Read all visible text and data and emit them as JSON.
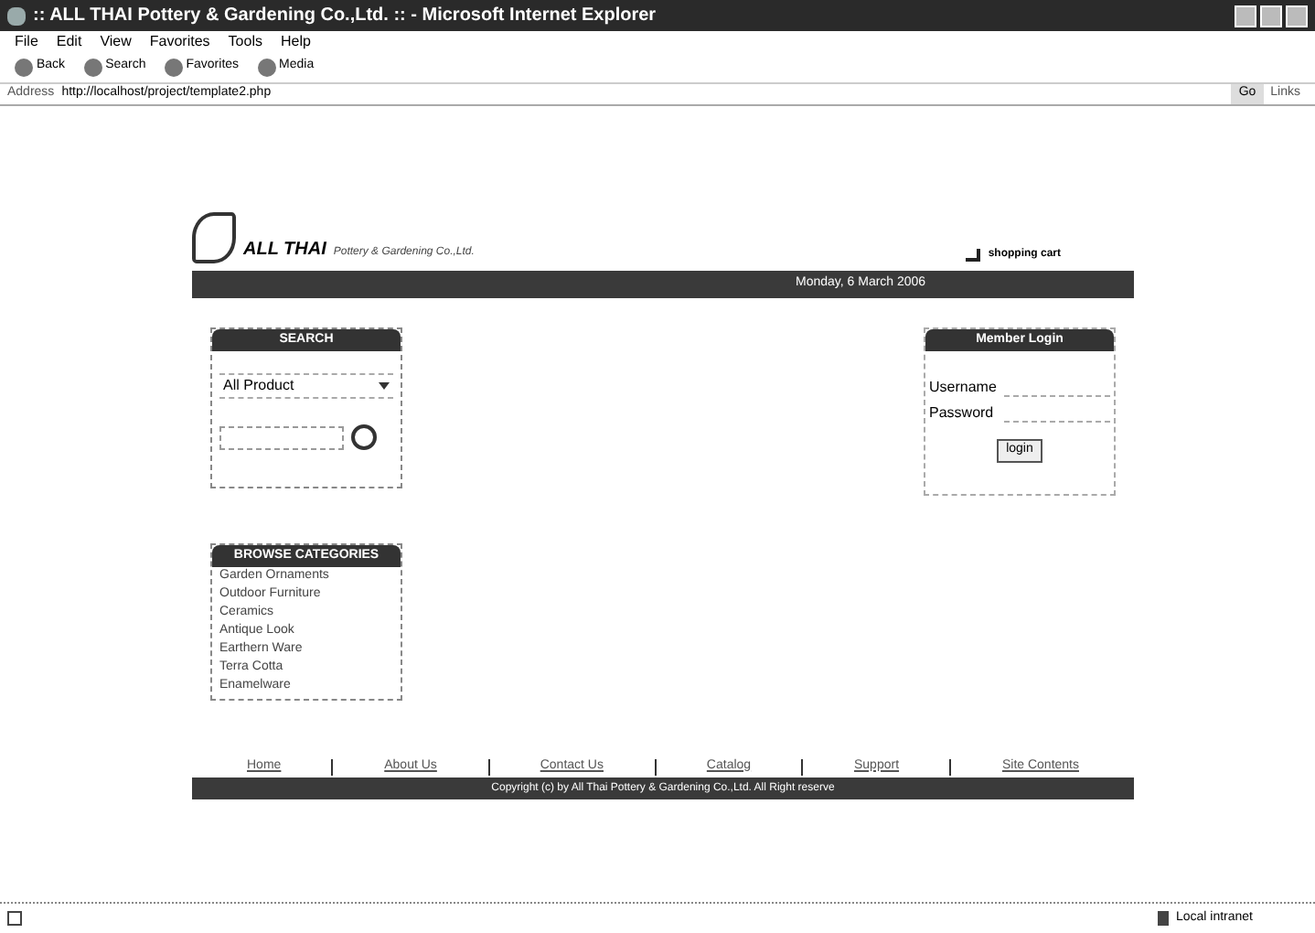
{
  "window": {
    "title": ":: ALL THAI Pottery & Gardening Co.,Ltd. :: - Microsoft Internet Explorer"
  },
  "menu": [
    "File",
    "Edit",
    "View",
    "Favorites",
    "Tools",
    "Help"
  ],
  "toolbar": [
    "Back",
    "Search",
    "Favorites",
    "Media"
  ],
  "address_bar": {
    "label": "Address",
    "url": "http://localhost/project/template2.php",
    "go": "Go",
    "links": "Links"
  },
  "site": {
    "logo_name": "ALL THAI",
    "logo_tagline": "Pottery & Gardening Co.,Ltd.",
    "cart": "shopping cart",
    "date": "Monday, 6 March 2006"
  },
  "search": {
    "title": "SEARCH",
    "category": "All Product"
  },
  "categories": {
    "title": "BROWSE CATEGORIES",
    "items": [
      "Garden Ornaments",
      "Outdoor Furniture",
      "Ceramics",
      "Antique Look",
      "Earthern Ware",
      "Terra Cotta",
      "Enamelware"
    ]
  },
  "login": {
    "title": "Member Login",
    "username_label": "Username",
    "password_label": "Password",
    "button": "login"
  },
  "footer": {
    "links": [
      "Home",
      "About Us",
      "Contact Us",
      "Catalog",
      "Support",
      "Site Contents"
    ],
    "copyright": "Copyright (c) by All Thai Pottery & Gardening Co.,Ltd. All Right reserve"
  },
  "status_bar": {
    "zone": "Local intranet"
  }
}
